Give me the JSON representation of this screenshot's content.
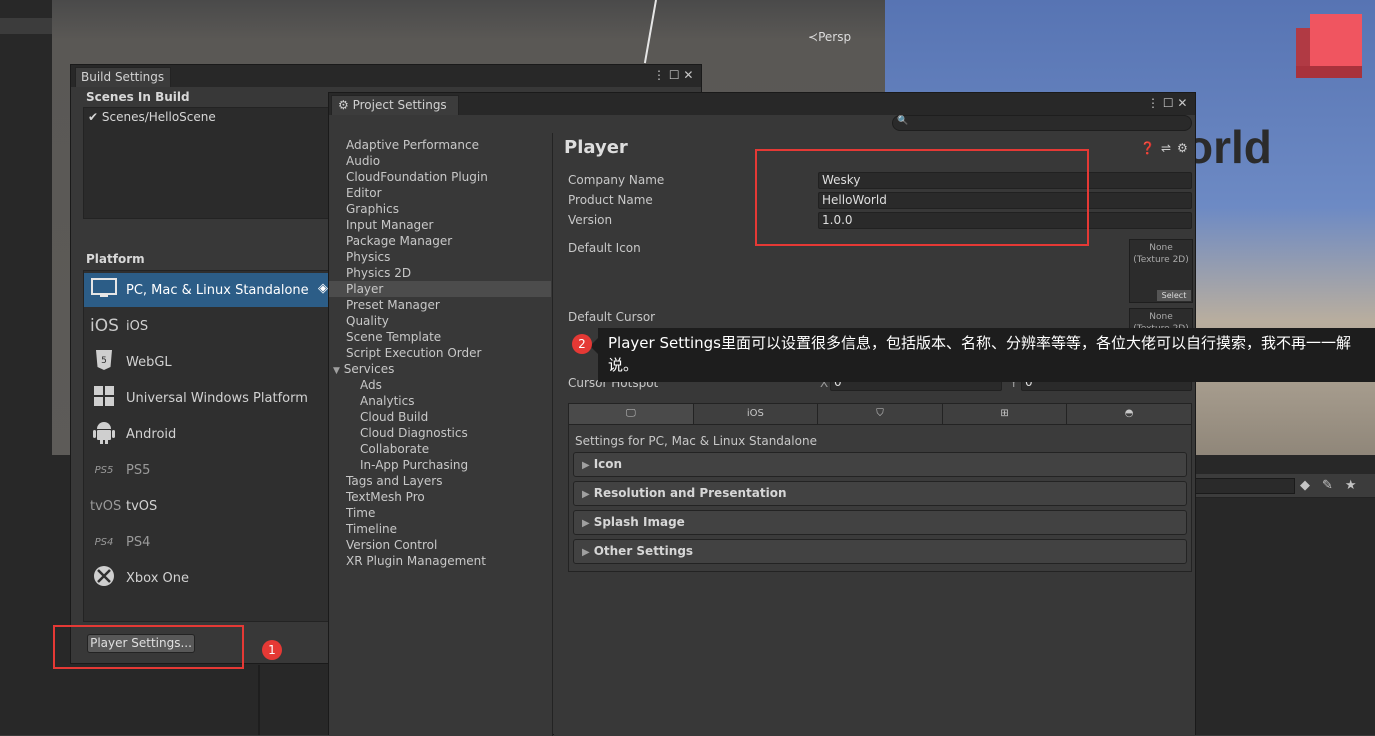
{
  "scene_view": {
    "persp_label": "Persp",
    "game_text": "orld"
  },
  "build_settings": {
    "tab_title": "Build Settings",
    "scenes_title": "Scenes In Build",
    "scene_items": [
      "Scenes/HelloScene"
    ],
    "platform_title": "Platform",
    "platforms": [
      {
        "label": "PC, Mac & Linux Standalone",
        "icon": "monitor-icon",
        "selected": true
      },
      {
        "label": "iOS",
        "icon": "ios-icon"
      },
      {
        "label": "WebGL",
        "icon": "html5-icon"
      },
      {
        "label": "Universal Windows Platform",
        "icon": "windows-icon"
      },
      {
        "label": "Android",
        "icon": "android-icon"
      },
      {
        "label": "PS5",
        "icon": "ps5-icon"
      },
      {
        "label": "tvOS",
        "icon": "tvos-icon"
      },
      {
        "label": "PS4",
        "icon": "ps4-icon"
      },
      {
        "label": "Xbox One",
        "icon": "xbox-icon"
      }
    ],
    "player_settings_button": "Player Settings...",
    "annotation_number": "1"
  },
  "project_settings": {
    "tab_title": "Project Settings",
    "sidebar": [
      {
        "label": "Adaptive Performance",
        "indent": 0
      },
      {
        "label": "Audio",
        "indent": 0
      },
      {
        "label": "CloudFoundation Plugin",
        "indent": 0
      },
      {
        "label": "Editor",
        "indent": 0
      },
      {
        "label": "Graphics",
        "indent": 0
      },
      {
        "label": "Input Manager",
        "indent": 0
      },
      {
        "label": "Package Manager",
        "indent": 0
      },
      {
        "label": "Physics",
        "indent": 0
      },
      {
        "label": "Physics 2D",
        "indent": 0
      },
      {
        "label": "Player",
        "indent": 0,
        "selected": true
      },
      {
        "label": "Preset Manager",
        "indent": 0
      },
      {
        "label": "Quality",
        "indent": 0
      },
      {
        "label": "Scene Template",
        "indent": 0
      },
      {
        "label": "Script Execution Order",
        "indent": 0
      },
      {
        "label": "Services",
        "indent": 0,
        "expanded": true
      },
      {
        "label": "Ads",
        "indent": 1
      },
      {
        "label": "Analytics",
        "indent": 1
      },
      {
        "label": "Cloud Build",
        "indent": 1
      },
      {
        "label": "Cloud Diagnostics",
        "indent": 1
      },
      {
        "label": "Collaborate",
        "indent": 1
      },
      {
        "label": "In-App Purchasing",
        "indent": 1
      },
      {
        "label": "Tags and Layers",
        "indent": 0
      },
      {
        "label": "TextMesh Pro",
        "indent": 0
      },
      {
        "label": "Time",
        "indent": 0
      },
      {
        "label": "Timeline",
        "indent": 0
      },
      {
        "label": "Version Control",
        "indent": 0
      },
      {
        "label": "XR Plugin Management",
        "indent": 0
      }
    ],
    "player": {
      "title": "Player",
      "company_name_label": "Company Name",
      "company_name": "Wesky",
      "product_name_label": "Product Name",
      "product_name": "HelloWorld",
      "version_label": "Version",
      "version": "1.0.0",
      "default_icon_label": "Default Icon",
      "default_cursor_label": "Default Cursor",
      "texture_none": "None",
      "texture_type": "(Texture 2D)",
      "select_label": "Select",
      "cursor_hotspot_label": "Cursor Hotspot",
      "hotspot_x_label": "X",
      "hotspot_x": "0",
      "hotspot_y_label": "Y",
      "hotspot_y": "0",
      "platform_tabs": [
        "monitor-icon",
        "iOS",
        "html5-icon",
        "windows-icon",
        "android-icon"
      ],
      "settings_for": "Settings for PC, Mac & Linux Standalone",
      "foldouts": [
        "Icon",
        "Resolution and Presentation",
        "Splash Image",
        "Other Settings"
      ]
    }
  },
  "tooltip": {
    "number": "2",
    "text": "Player Settings里面可以设置很多信息，包括版本、名称、分辨率等等，各位大佬可以自行摸索，我不再一一解说。"
  },
  "colors": {
    "accent_selection": "#2c5d87",
    "annotation_red": "#e53935"
  }
}
